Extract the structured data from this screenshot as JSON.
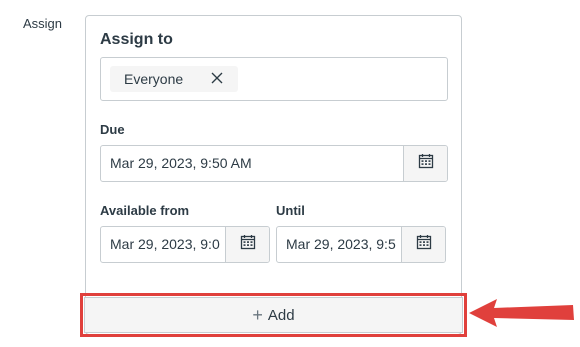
{
  "side_label": "Assign",
  "assign": {
    "title": "Assign to",
    "chip_label": "Everyone"
  },
  "due": {
    "label": "Due",
    "value": "Mar 29, 2023, 9:50 AM"
  },
  "available_from": {
    "label": "Available from",
    "value": "Mar 29, 2023, 9:0"
  },
  "until": {
    "label": "Until",
    "value": "Mar 29, 2023, 9:5"
  },
  "add_button": {
    "label": "Add"
  },
  "colors": {
    "highlight": "#e0403c",
    "border": "#c7cdd1",
    "text": "#2d3b45"
  }
}
